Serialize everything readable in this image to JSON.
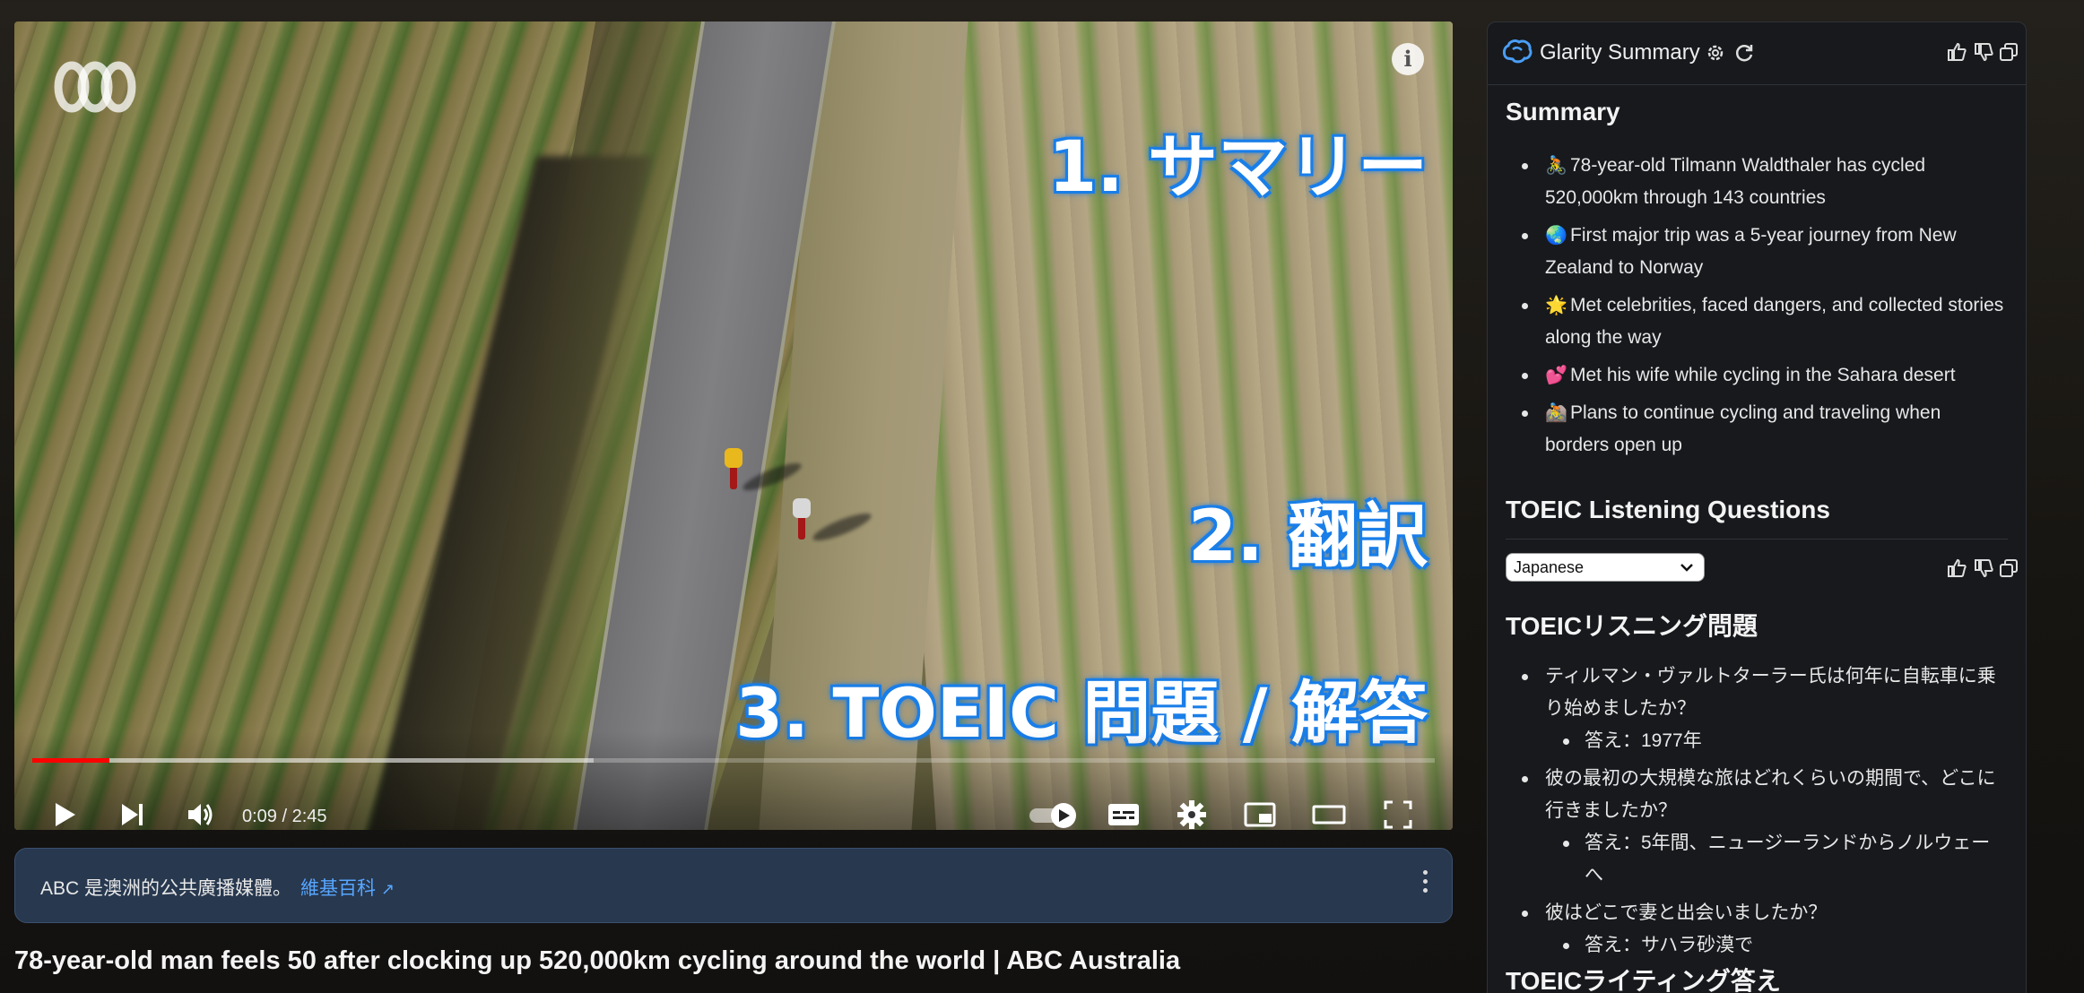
{
  "video": {
    "overlay_1": "1. サマリー",
    "overlay_2": "2. 翻訳",
    "overlay_3": "3. TOEIC 問題 / 解答",
    "time": "0:09 / 2:45",
    "progress_fraction": 0.055,
    "buffered_fraction": 0.4
  },
  "infobar": {
    "text": "ABC 是澳洲的公共廣播媒體。",
    "link": "維基百科"
  },
  "video_title": "78-year-old man feels 50 after clocking up 520,000km cycling around the world | ABC Australia",
  "panel": {
    "brand": "Glarity Summary",
    "summary_title": "Summary",
    "summary_items": [
      {
        "emoji": "🚴",
        "text": "78-year-old Tilmann Waldthaler has cycled 520,000km through 143 countries"
      },
      {
        "emoji": "🌏",
        "text": "First major trip was a 5-year journey from New Zealand to Norway"
      },
      {
        "emoji": "🌟",
        "text": "Met celebrities, faced dangers, and collected stories along the way"
      },
      {
        "emoji": "💕",
        "text": "Met his wife while cycling in the Sahara desert"
      },
      {
        "emoji": "🚵",
        "text": "Plans to continue cycling and traveling when borders open up"
      }
    ],
    "toeic_title": "TOEIC Listening Questions",
    "language": "Japanese",
    "jp_title": "TOEICリスニング問題",
    "questions": [
      {
        "q": "ティルマン・ヴァルトターラー氏は何年に自転車に乗り始めましたか？",
        "a": "答え：1977年"
      },
      {
        "q": "彼の最初の大規模な旅はどれくらいの期間で、どこに行きましたか？",
        "a": "答え：5年間、ニュージーランドからノルウェーへ"
      },
      {
        "q": "彼はどこで妻と出会いましたか？",
        "a": "答え：サハラ砂漠で"
      }
    ],
    "writing_title": "TOEICライティング答え"
  }
}
